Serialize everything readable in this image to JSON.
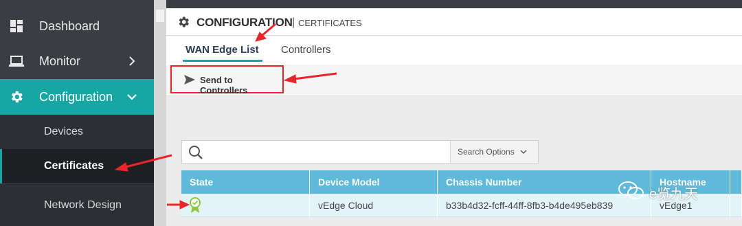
{
  "sidebar": {
    "items": [
      {
        "label": "Dashboard",
        "icon": "dashboard-icon"
      },
      {
        "label": "Monitor",
        "icon": "monitor-icon"
      },
      {
        "label": "Configuration",
        "icon": "gear-icon"
      }
    ],
    "subitems": [
      {
        "label": "Devices"
      },
      {
        "label": "Certificates"
      },
      {
        "label": "Network Design"
      }
    ]
  },
  "header": {
    "title": "CONFIGURATION",
    "separator": "|",
    "subtitle": "CERTIFICATES"
  },
  "tabs": [
    {
      "label": "WAN Edge List"
    },
    {
      "label": "Controllers"
    }
  ],
  "toolbar": {
    "send_label": "Send to Controllers"
  },
  "search": {
    "placeholder": "",
    "options_label": "Search Options"
  },
  "table": {
    "columns": [
      "State",
      "Device Model",
      "Chassis Number",
      "Hostname"
    ],
    "rows": [
      {
        "state": "certificate-ok-icon",
        "model": "vEdge Cloud",
        "chassis": "b33b4d32-fcff-44ff-8fb3-b4de495eb839",
        "hostname": "vEdge1"
      }
    ]
  },
  "watermark": {
    "text": "e览九天"
  },
  "colors": {
    "accent": "#16a7a5",
    "sidebar": "#3a3d42",
    "table_header": "#5fb9d8",
    "annotation": "#e8262a"
  }
}
